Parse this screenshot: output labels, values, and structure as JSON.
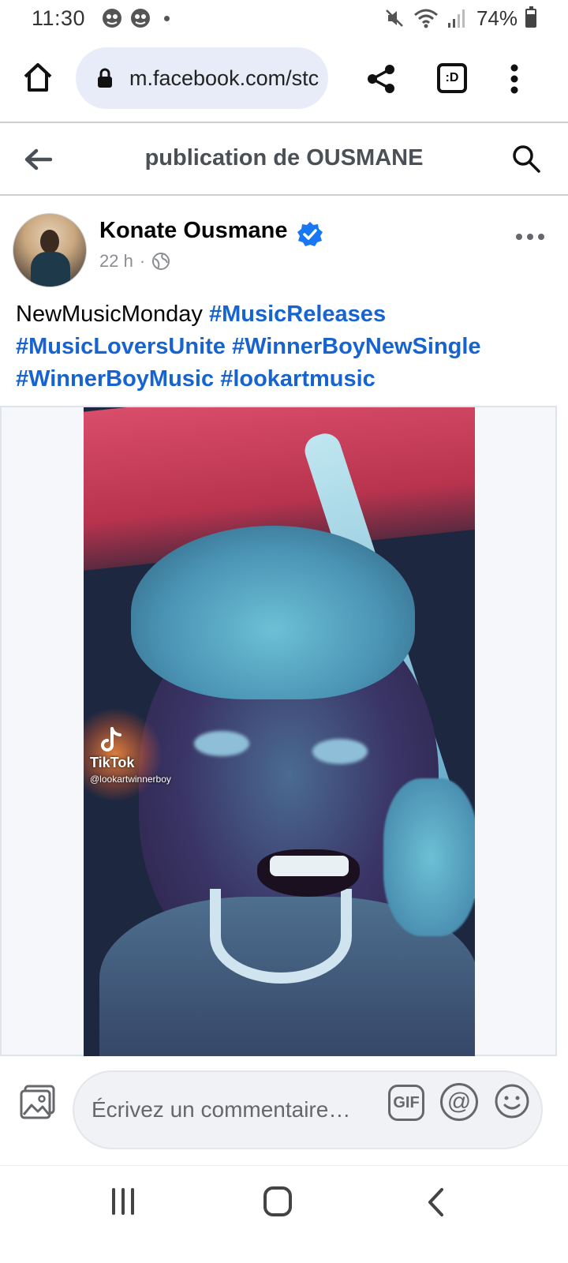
{
  "status_bar": {
    "time": "11:30",
    "battery_text": "74%",
    "battery_level": 0.74
  },
  "browser": {
    "url": "m.facebook.com/stc",
    "tabs_label": ":D"
  },
  "page": {
    "title": "publication de OUSMANE"
  },
  "post": {
    "author": "Konate Ousmane",
    "time_ago": "22 h",
    "separator": "·",
    "text_plain": "NewMusicMonday ",
    "hashtags": [
      "#MusicReleases",
      "#MusicLoversUnite",
      "#WinnerBoyNewSingle",
      "#WinnerBoyMusic",
      "#lookartmusic"
    ],
    "video": {
      "overlay_app": "TikTok",
      "overlay_handle": "@lookartwinnerboy"
    }
  },
  "comment": {
    "placeholder": "Écrivez un commentaire…",
    "gif_label": "GIF",
    "mention_label": "@"
  },
  "colors": {
    "accent": "#1763cf",
    "verified": "#1877f2",
    "url_bg": "#e8ecf8"
  }
}
